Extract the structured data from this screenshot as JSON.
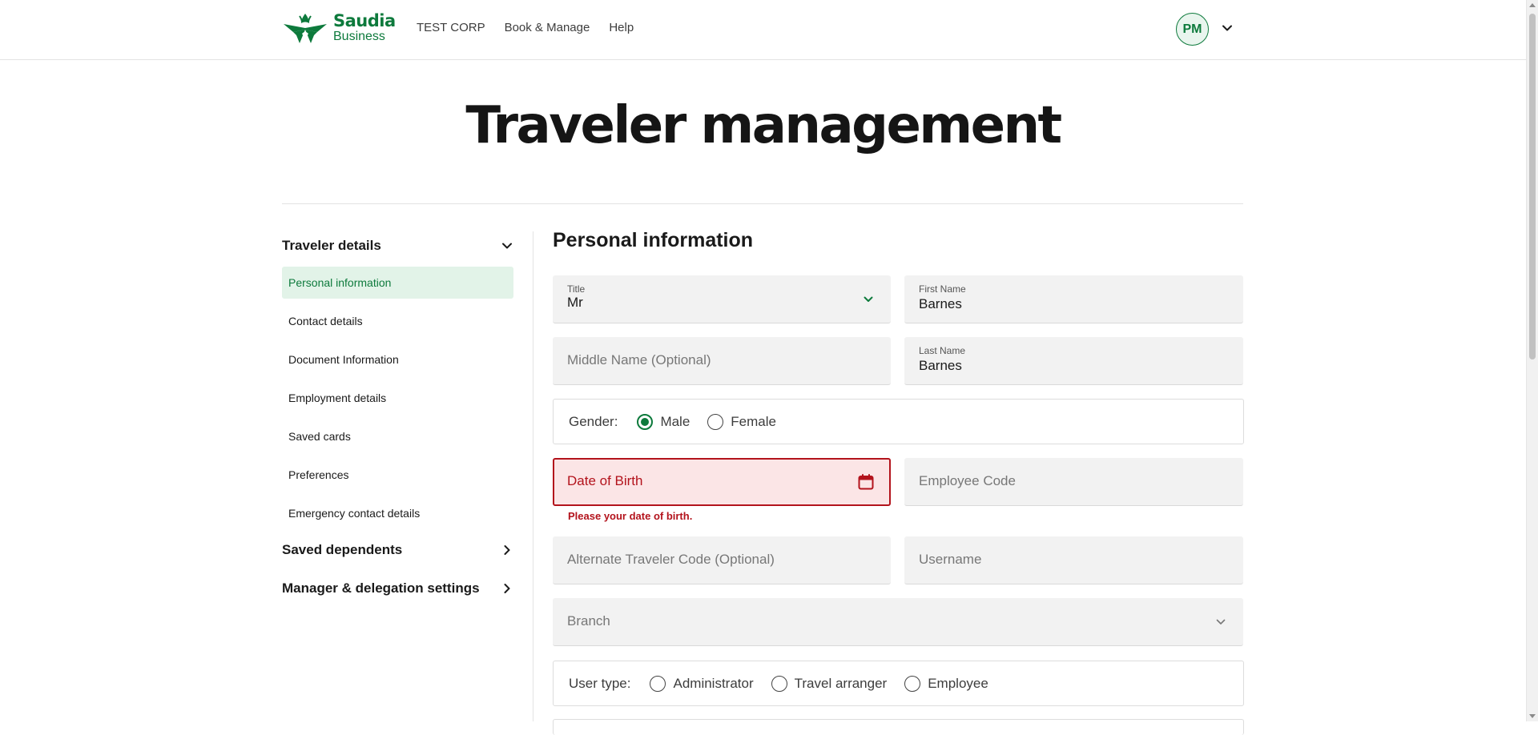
{
  "header": {
    "logo_line1": "Saudia",
    "logo_line2": "Business",
    "nav": [
      "TEST CORP",
      "Book & Manage",
      "Help"
    ],
    "avatar_initials": "PM"
  },
  "page": {
    "title": "Traveler management"
  },
  "sidebar": {
    "sections": [
      {
        "label": "Traveler details",
        "expanded": true,
        "items": [
          "Personal information",
          "Contact details",
          "Document Information",
          "Employment details",
          "Saved cards",
          "Preferences",
          "Emergency contact details"
        ],
        "active_item": "Personal information"
      },
      {
        "label": "Saved dependents",
        "expanded": false
      },
      {
        "label": "Manager & delegation settings",
        "expanded": false
      }
    ]
  },
  "form": {
    "section_title": "Personal information",
    "title_field": {
      "label": "Title",
      "value": "Mr"
    },
    "first_name": {
      "label": "First Name",
      "value": "Barnes"
    },
    "middle_name": {
      "placeholder": "Middle Name (Optional)"
    },
    "last_name": {
      "label": "Last Name",
      "value": "Barnes"
    },
    "gender": {
      "label": "Gender:",
      "options": [
        "Male",
        "Female"
      ],
      "selected": "Male"
    },
    "dob": {
      "placeholder": "Date of Birth",
      "error": "Please your date of birth."
    },
    "employee_code": {
      "placeholder": "Employee Code"
    },
    "alt_traveler_code": {
      "placeholder": "Alternate Traveler Code (Optional)"
    },
    "username": {
      "placeholder": "Username"
    },
    "branch": {
      "placeholder": "Branch"
    },
    "user_type": {
      "label": "User type:",
      "options": [
        "Administrator",
        "Travel arranger",
        "Employee"
      ],
      "selected": null
    }
  },
  "colors": {
    "brand_green": "#0d7a3c",
    "active_bg": "#e2f3e8",
    "error_red": "#b3131c",
    "error_bg": "#fbe5e6",
    "field_bg": "#f2f2f2"
  },
  "icons": [
    "saudia-logo",
    "chevron-down-icon",
    "chevron-right-icon",
    "calendar-icon"
  ]
}
